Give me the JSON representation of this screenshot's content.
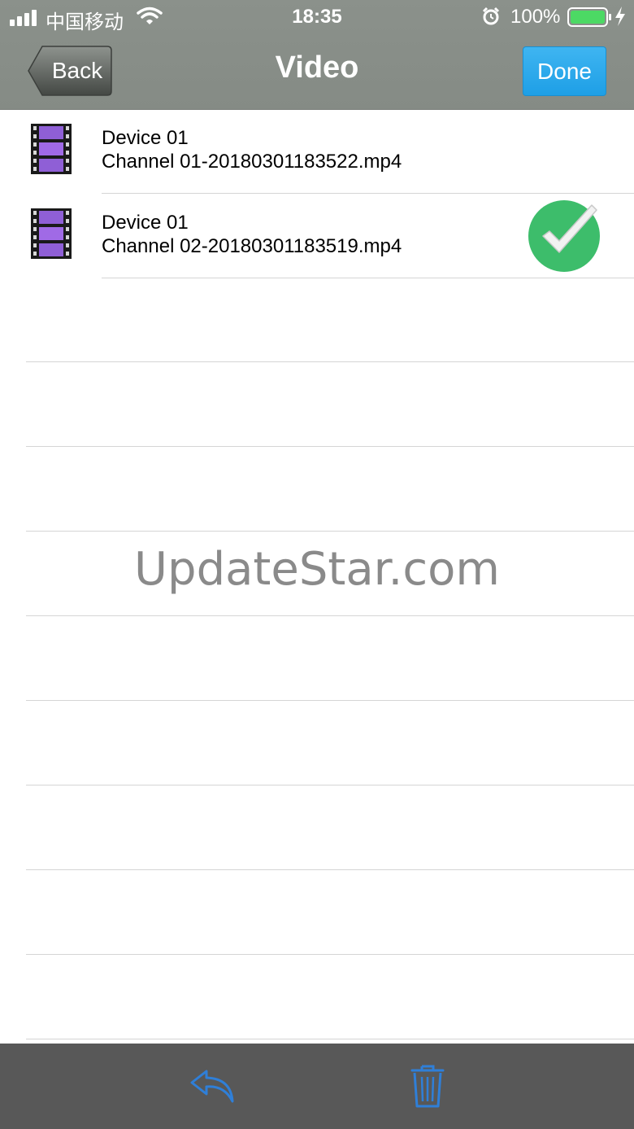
{
  "status_bar": {
    "carrier": "中国移动",
    "time": "18:35",
    "battery_percent": "100%",
    "battery_level": 1.0,
    "icons": [
      "signal-icon",
      "wifi-icon",
      "alarm-icon",
      "battery-icon",
      "charging-icon"
    ]
  },
  "nav": {
    "back_label": "Back",
    "title": "Video",
    "done_label": "Done",
    "done_color": "#1e9fe6"
  },
  "files": [
    {
      "device": "Device 01",
      "filename": "Channel 01-20180301183522.mp4",
      "selected": false,
      "icon": "film-icon"
    },
    {
      "device": "Device 01",
      "filename": "Channel 02-20180301183519.mp4",
      "selected": true,
      "icon": "film-icon"
    }
  ],
  "watermark": "UpdateStar.com",
  "toolbar": {
    "icons": [
      "reply-icon",
      "trash-icon"
    ],
    "icon_color": "#2f7fd8"
  }
}
